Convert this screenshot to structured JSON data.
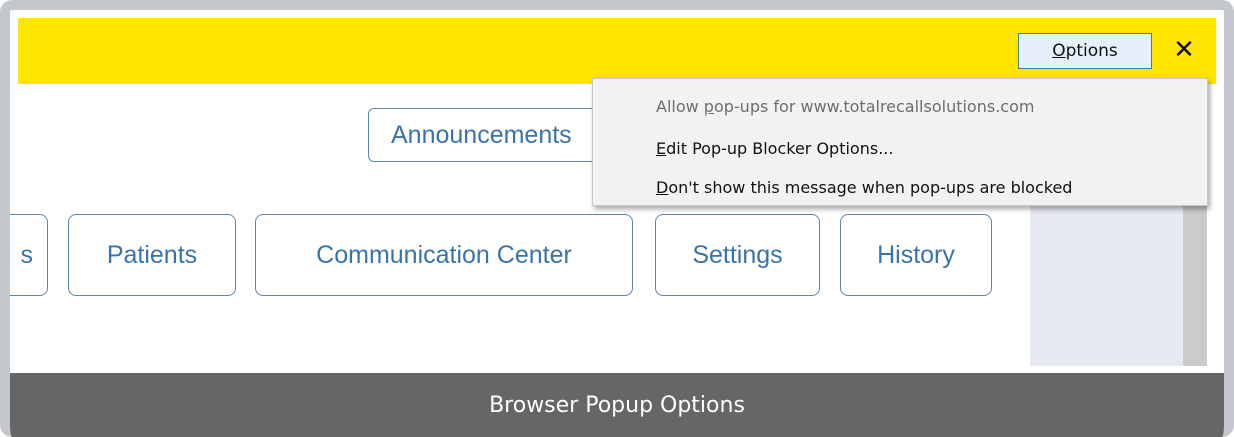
{
  "notification_bar": {
    "options_button": {
      "accel": "O",
      "rest": "ptions"
    },
    "close_symbol": "✕"
  },
  "page": {
    "announcements_label": "Announcements",
    "nav": {
      "partial_label": "s",
      "patients": "Patients",
      "communication_center": "Communication Center",
      "settings": "Settings",
      "history": "History"
    }
  },
  "popup_menu": {
    "items": [
      {
        "pre": "Allow ",
        "accel": "p",
        "post": "op-ups for www.totalrecallsolutions.com",
        "enabled": false
      },
      {
        "pre": "",
        "accel": "E",
        "post": "dit Pop-up Blocker Options...",
        "enabled": true
      },
      {
        "pre": "",
        "accel": "D",
        "post": "on't show this message when pop-ups are blocked",
        "enabled": true
      }
    ]
  },
  "caption": "Browser Popup Options",
  "colors": {
    "notification_bar": "#ffe500",
    "button_text": "#3a73a8",
    "button_border": "#5a86b0",
    "caption_bar": "#666666",
    "menu_background": "#f2f2f2",
    "disabled_text": "#6d6d6d"
  }
}
